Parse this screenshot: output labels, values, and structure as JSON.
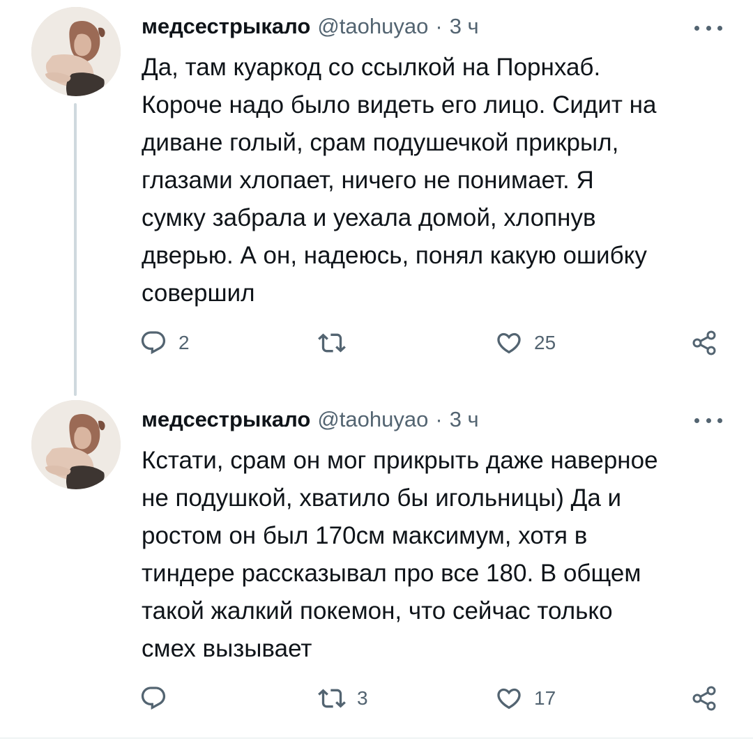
{
  "tweets": [
    {
      "display_name": "медсестрыкало",
      "handle": "@taohuyao",
      "separator": "·",
      "time": "3 ч",
      "text": "Да, там куаркод со ссылкой на Порнхаб.\nКороче надо было видеть его лицо. Сидит на\nдиване голый, срам подушечкой прикрыл,\nглазами хлопает, ничего не понимает. Я\nсумку забрала и уехала домой, хлопнув\nдверью. А он, надеюсь, понял какую ошибку\nсовершил",
      "reply_count": "2",
      "retweet_count": "",
      "like_count": "25"
    },
    {
      "display_name": "медсестрыкало",
      "handle": "@taohuyao",
      "separator": "·",
      "time": "3 ч",
      "text": "Кстати, срам он мог прикрыть даже наверное\nне подушкой, хватило бы игольницы) Да и\nростом он был 170см максимум, хотя в\nтиндере рассказывал про все 180. В общем\nтакой жалкий покемон, что сейчас только\nсмех вызывает",
      "reply_count": "",
      "retweet_count": "3",
      "like_count": "17"
    }
  ],
  "icons": {
    "reply": "reply-icon",
    "retweet": "retweet-icon",
    "like": "heart-icon",
    "share": "share-icon",
    "more": "more-icon"
  },
  "colors": {
    "text": "#0f1419",
    "secondary": "#536471",
    "thread_line": "#cfd9de"
  }
}
